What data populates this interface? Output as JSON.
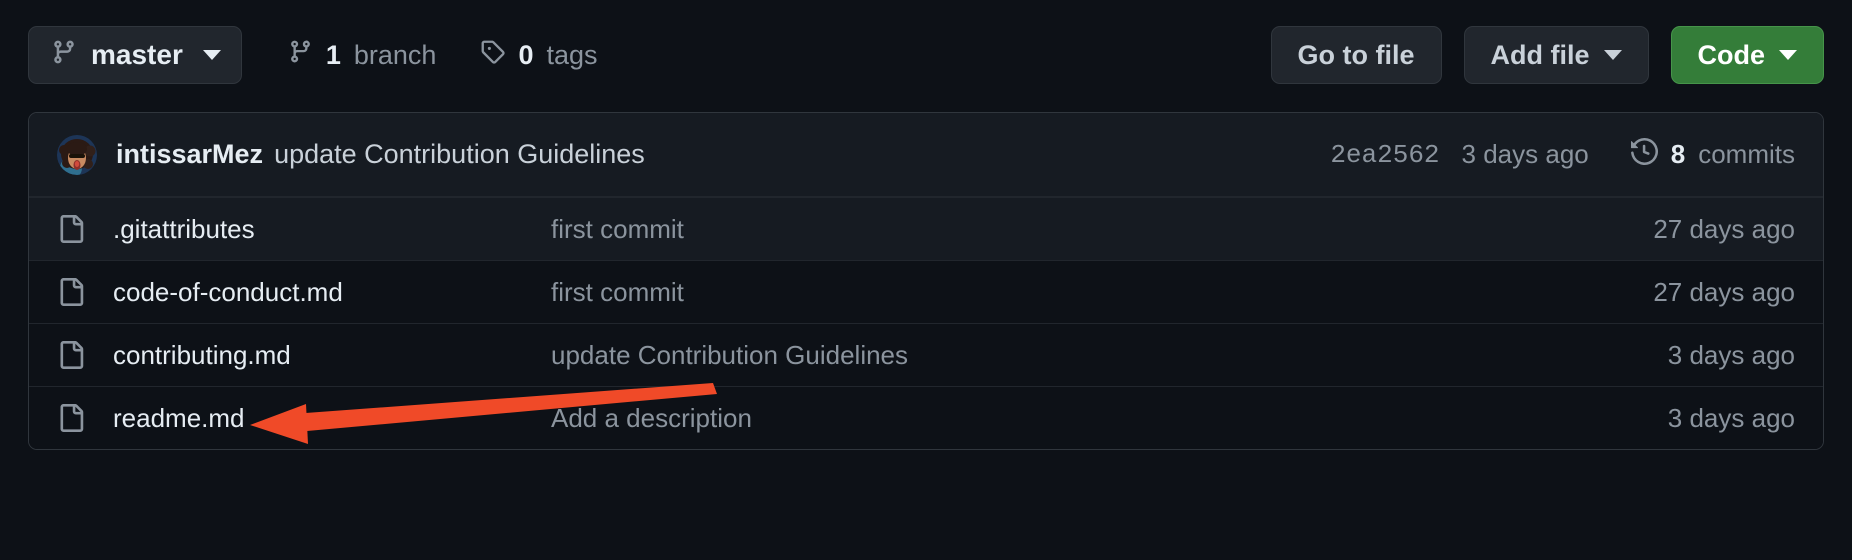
{
  "toolbar": {
    "branch_button": {
      "label": "master",
      "icon": "git-branch-icon",
      "caret": "chevron-down-icon"
    },
    "branch_count": {
      "number": "1",
      "label": "branch",
      "icon": "git-branch-icon"
    },
    "tag_count": {
      "number": "0",
      "label": "tags",
      "icon": "tag-icon"
    },
    "go_to_file_label": "Go to file",
    "add_file_label": "Add file",
    "code_label": "Code"
  },
  "commit_header": {
    "author": "intissarMez",
    "message": "update Contribution Guidelines",
    "hash": "2ea2562",
    "date": "3 days ago",
    "commits_icon": "history-icon",
    "commits_count": "8",
    "commits_label": "commits"
  },
  "files": [
    {
      "icon": "file-icon",
      "name": ".gitattributes",
      "message": "first commit",
      "date": "27 days ago"
    },
    {
      "icon": "file-icon",
      "name": "code-of-conduct.md",
      "message": "first commit",
      "date": "27 days ago"
    },
    {
      "icon": "file-icon",
      "name": "contributing.md",
      "message": "update Contribution Guidelines",
      "date": "3 days ago"
    },
    {
      "icon": "file-icon",
      "name": "readme.md",
      "message": "Add a description",
      "date": "3 days ago"
    }
  ],
  "annotation": {
    "type": "arrow",
    "color": "#f04a28",
    "points_to": "readme.md"
  },
  "colors": {
    "page_background": "#0d1117",
    "row_alt_background": "#161b22",
    "border": "#30363d",
    "primary_button": "#347d39",
    "text_primary": "#e6edf3",
    "text_muted": "#8b949e",
    "annotation": "#f04a28"
  }
}
